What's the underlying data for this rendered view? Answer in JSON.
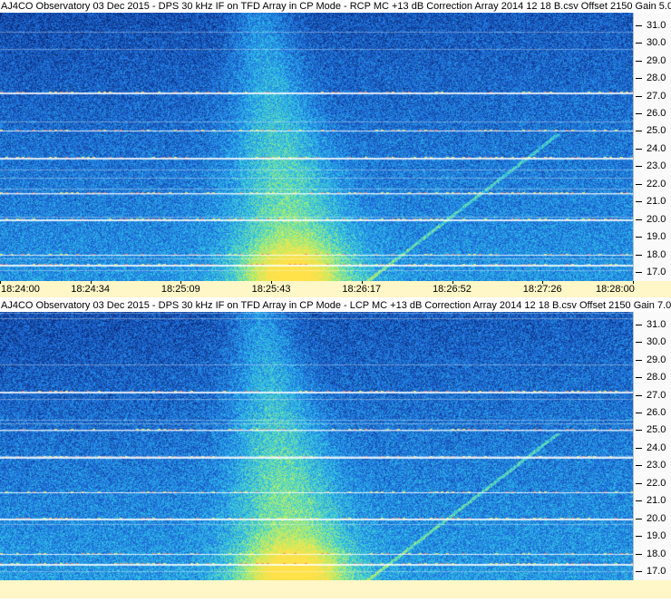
{
  "panels": [
    {
      "title": "AJ4CO Observatory 03 Dec 2015 - DPS 30 kHz IF on TFD Array in CP Mode - RCP  MC +13 dB  Correction Array 2014 12 18 B.csv  Offset 2150  Gain 5.0",
      "y_ticks": [
        "31.0",
        "30.0",
        "29.0",
        "28.0",
        "27.0",
        "26.0",
        "25.0",
        "24.0",
        "23.0",
        "22.0",
        "21.0",
        "20.0",
        "19.0",
        "18.0",
        "17.0"
      ],
      "x_ticks": [
        "18:24:00",
        "18:24:34",
        "18:25:09",
        "18:25:43",
        "18:26:17",
        "18:26:52",
        "18:27:26",
        "18:28:00"
      ]
    },
    {
      "title": "AJ4CO Observatory 03 Dec 2015 - DPS 30 kHz IF on TFD Array in CP Mode - LCP  MC +13 dB  Correction Array 2014 12 18 B.csv  Offset 2150  Gain 7.0",
      "y_ticks": [
        "31.0",
        "30.0",
        "29.0",
        "28.0",
        "27.0",
        "26.0",
        "25.0",
        "24.0",
        "23.0",
        "22.0",
        "21.0",
        "20.0",
        "19.0",
        "18.0",
        "17.0"
      ],
      "x_ticks": []
    }
  ],
  "chart_data": [
    {
      "type": "heatmap",
      "title": "AJ4CO Observatory 03 Dec 2015 - DPS 30 kHz IF on TFD Array in CP Mode - RCP  MC +13 dB  Correction Array 2014 12 18 B.csv  Offset 2150  Gain 5.0",
      "xlabel": "",
      "ylabel": "",
      "x_range": [
        "18:24:00",
        "18:28:00"
      ],
      "ylim": [
        16.5,
        31.7
      ],
      "interference_lines": [
        27.2,
        25.0,
        23.5,
        21.5,
        20.0,
        18.0,
        17.4
      ],
      "colormap": [
        "#0a2a78",
        "#1f6fe0",
        "#2fc6e8",
        "#a8f070",
        "#ffe14a"
      ]
    },
    {
      "type": "heatmap",
      "title": "AJ4CO Observatory 03 Dec 2015 - DPS 30 kHz IF on TFD Array in CP Mode - LCP  MC +13 dB  Correction Array 2014 12 18 B.csv  Offset 2150  Gain 7.0",
      "xlabel": "",
      "ylabel": "",
      "x_range": [
        "18:24:00",
        "18:28:00"
      ],
      "ylim": [
        16.5,
        31.7
      ],
      "interference_lines": [
        27.2,
        25.0,
        23.5,
        21.5,
        20.0,
        18.0,
        17.4
      ],
      "colormap": [
        "#0a2a78",
        "#1f6fe0",
        "#2fc6e8",
        "#a8f070",
        "#ffe14a"
      ]
    }
  ]
}
